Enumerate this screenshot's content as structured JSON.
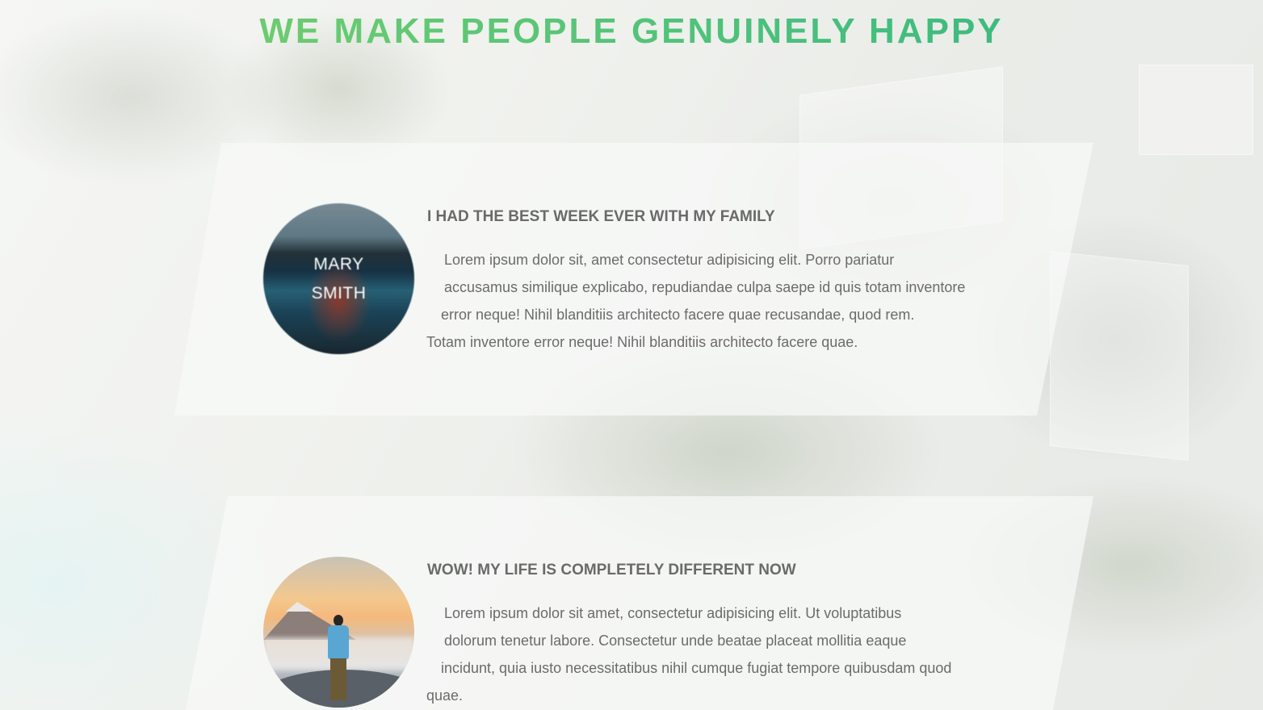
{
  "header": {
    "title": "WE MAKE PEOPLE GENUINELY HAPPY"
  },
  "testimonials": [
    {
      "avatar_name_line1": "MARY",
      "avatar_name_line2": "SMITH",
      "heading": "I HAD THE BEST WEEK EVER WITH MY FAMILY",
      "lines": [
        "Lorem ipsum dolor sit, amet consectetur adipisicing elit. Porro pariatur",
        "accusamus similique explicabo, repudiandae culpa saepe id quis totam inventore",
        "error neque! Nihil blanditiis architecto facere quae recusandae, quod rem.",
        "Totam inventore error neque! Nihil blanditiis architecto facere quae."
      ]
    },
    {
      "heading": "WOW! MY LIFE IS COMPLETELY DIFFERENT NOW",
      "lines": [
        "Lorem ipsum dolor sit amet, consectetur adipisicing elit. Ut voluptatibus",
        "dolorum tenetur labore. Consectetur unde beatae placeat mollitia eaque",
        "incidunt, quia iusto necessitatibus nihil cumque fugiat tempore quibusdam quod",
        "quae."
      ]
    }
  ],
  "colors": {
    "title_gradient_start": "#7dd16a",
    "title_gradient_end": "#2db584",
    "text_gray": "#6b6b6b"
  }
}
